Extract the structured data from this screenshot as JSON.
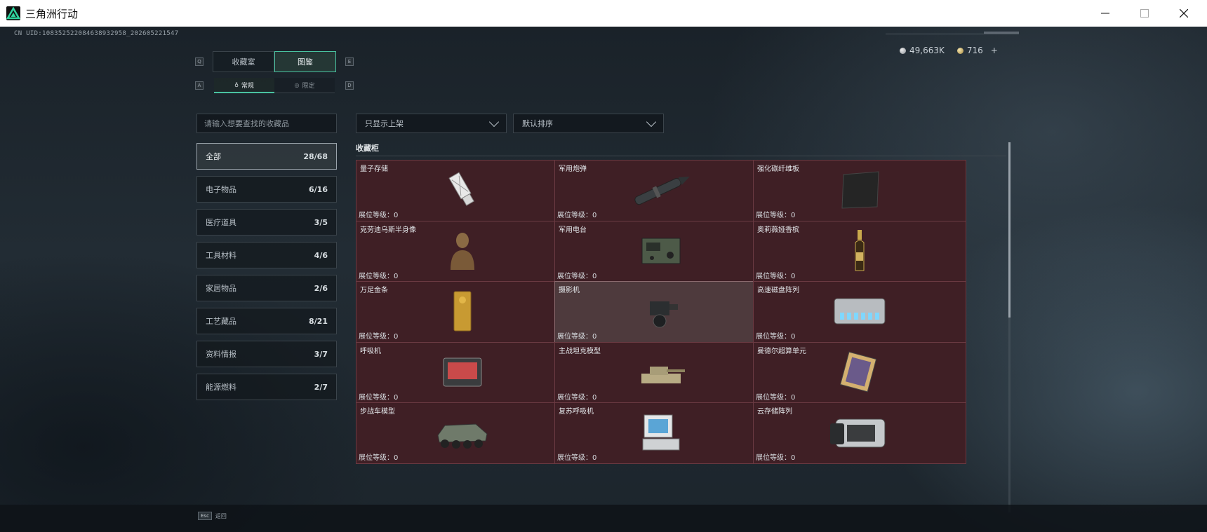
{
  "window": {
    "title": "三角洲行动"
  },
  "uid": "CN UID:1083525220846389329​58_202605221547",
  "currency": {
    "silver": "49,663K",
    "gold": "716",
    "plus": "+"
  },
  "tabs": [
    {
      "label": "收藏室",
      "key": "Q"
    },
    {
      "label": "图鉴",
      "key": "E"
    }
  ],
  "subtabs": [
    {
      "label": "常规",
      "key": "A"
    },
    {
      "label": "限定",
      "key": "D"
    }
  ],
  "search": {
    "placeholder": "请输入想要查找的收藏品"
  },
  "filters": {
    "show": "只显示上架",
    "sort": "默认排序"
  },
  "categories": [
    {
      "label": "全部",
      "count": "28/68"
    },
    {
      "label": "电子物品",
      "count": "6/16"
    },
    {
      "label": "医疗道具",
      "count": "3/5"
    },
    {
      "label": "工具材料",
      "count": "4/6"
    },
    {
      "label": "家居物品",
      "count": "2/6"
    },
    {
      "label": "工艺藏品",
      "count": "8/21"
    },
    {
      "label": "资料情报",
      "count": "3/7"
    },
    {
      "label": "能源燃料",
      "count": "2/7"
    }
  ],
  "section_title": "收藏柜",
  "level_label": "展位等级：0",
  "badge": "!",
  "items": [
    {
      "name": "量子存储",
      "icon": "usb-drive-icon"
    },
    {
      "name": "军用炮弹",
      "icon": "artillery-shell-icon"
    },
    {
      "name": "强化碳纤维板",
      "icon": "carbon-plate-icon"
    },
    {
      "name": "克劳迪乌斯半身像",
      "icon": "bust-statue-icon"
    },
    {
      "name": "军用电台",
      "icon": "military-radio-icon"
    },
    {
      "name": "奥莉薇娅香槟",
      "icon": "champagne-bottle-icon"
    },
    {
      "name": "万足金条",
      "icon": "gold-bar-icon"
    },
    {
      "name": "摄影机",
      "icon": "camera-icon"
    },
    {
      "name": "高速磁盘阵列",
      "icon": "disk-array-icon"
    },
    {
      "name": "呼吸机",
      "icon": "ventilator-icon"
    },
    {
      "name": "主战坦克模型",
      "icon": "tank-model-icon"
    },
    {
      "name": "曼德尔超算单元",
      "icon": "supercomputer-unit-icon"
    },
    {
      "name": "步战车模型",
      "icon": "ifv-model-icon"
    },
    {
      "name": "复苏呼吸机",
      "icon": "resuscitator-icon"
    },
    {
      "name": "云存储阵列",
      "icon": "cloud-storage-icon"
    }
  ],
  "esc": {
    "key": "Esc",
    "label": "返回"
  }
}
